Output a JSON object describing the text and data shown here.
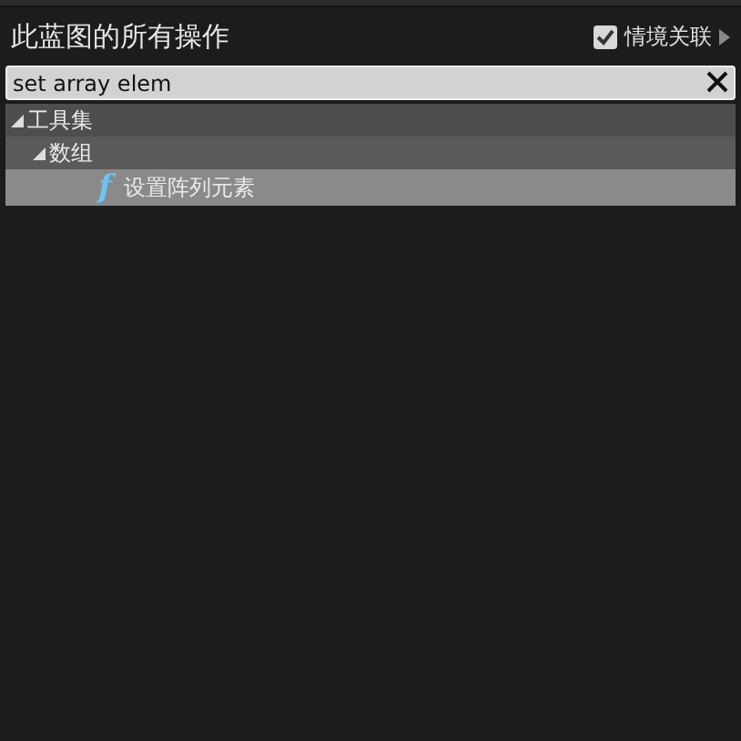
{
  "window": {
    "title": "此蓝图的所有操作"
  },
  "context_toggle": {
    "label": "情境关联",
    "checked": true
  },
  "search": {
    "value": "set array elem"
  },
  "tree": [
    {
      "label": "工具集",
      "kind": "category",
      "expanded": true,
      "children": [
        {
          "label": "数组",
          "kind": "category",
          "expanded": true,
          "children": [
            {
              "label": "设置阵列元素",
              "kind": "function",
              "icon": "f",
              "selected": true
            }
          ]
        }
      ]
    }
  ]
}
